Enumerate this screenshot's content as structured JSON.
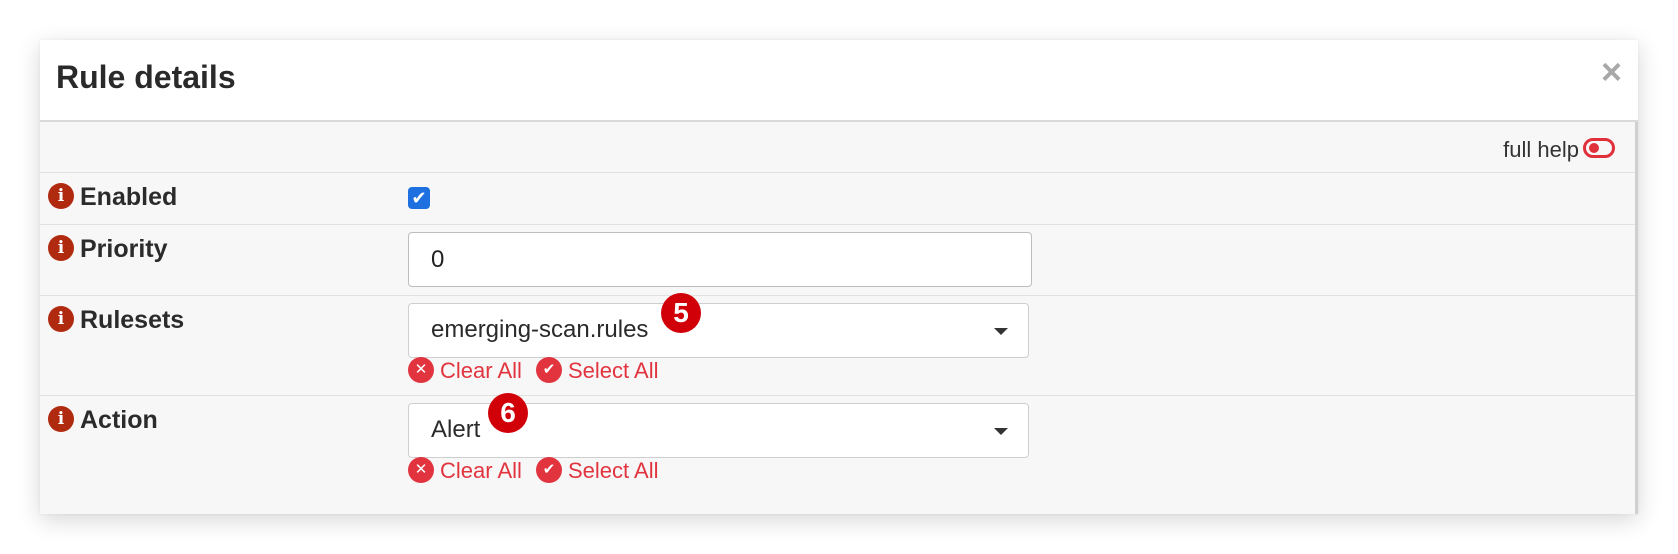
{
  "dialog": {
    "title": "Rule details",
    "close_glyph": "×"
  },
  "help": {
    "label": "full help",
    "toggle_icon": "toggle-off-icon"
  },
  "fields": {
    "enabled": {
      "label": "Enabled",
      "checked": true,
      "check_glyph": "✔"
    },
    "priority": {
      "label": "Priority",
      "value": "0"
    },
    "rulesets": {
      "label": "Rulesets",
      "selected": "emerging-scan.rules",
      "badge": "5",
      "clear_all": "Clear All",
      "select_all": "Select All"
    },
    "action": {
      "label": "Action",
      "selected": "Alert",
      "badge": "6",
      "clear_all": "Clear All",
      "select_all": "Select All"
    }
  },
  "icons": {
    "info": "i",
    "clear": "✕",
    "select": "✔"
  },
  "colors": {
    "info_icon": "#b02a10",
    "accent_red": "#e2343f",
    "badge_red": "#d10008",
    "checkbox_blue": "#1e6fe0"
  }
}
